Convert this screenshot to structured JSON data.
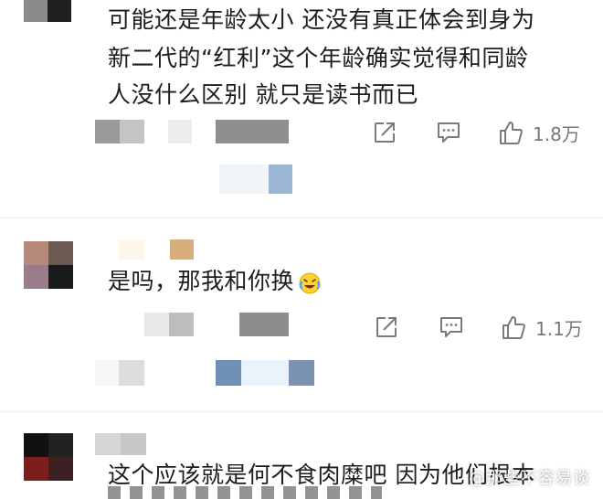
{
  "comments": [
    {
      "lines": [
        "可能还是年龄太小 还没有真正体会到身为",
        "新二代的“红利”这个年龄确实觉得和同龄",
        "人没什么区别 就只是读书而已"
      ],
      "like_count": "1.8万"
    },
    {
      "lines": [
        "是吗，那我和你换"
      ],
      "emoji_icon": "crying-laughing-emoji-icon",
      "like_count": "1.1万"
    },
    {
      "lines": [
        "这个应该就是何不食肉糜吧 因为他们根本"
      ]
    }
  ],
  "watermark": "@那些不容易谈",
  "colors": {
    "text": "#1c1c1c",
    "icon": "#7a7a7a",
    "divider": "#ececec"
  }
}
